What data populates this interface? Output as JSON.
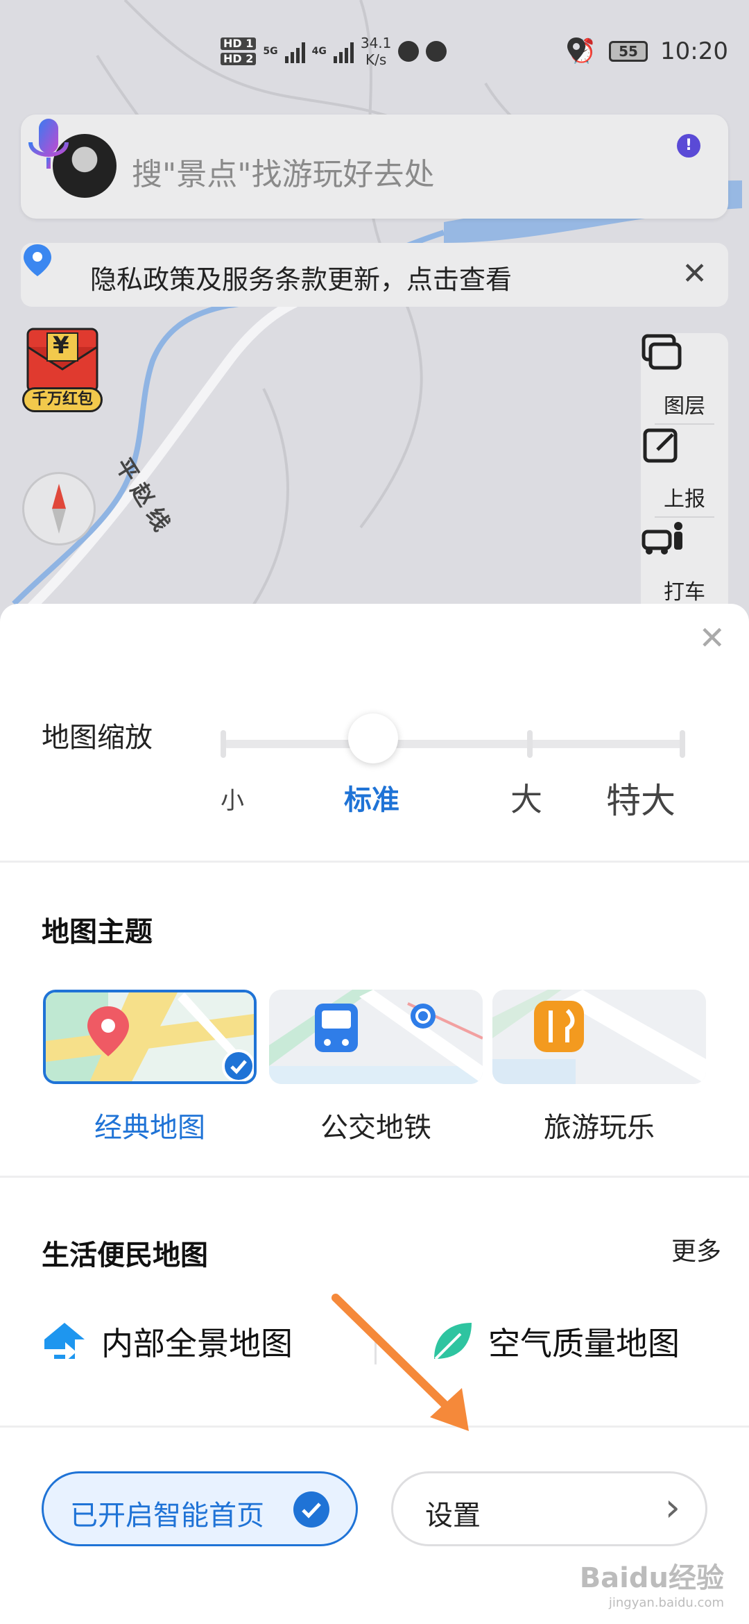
{
  "status_bar": {
    "speed_value": "34.1",
    "speed_unit": "K/s",
    "battery": "55",
    "time": "10:20",
    "net_5g": "5G",
    "net_4g": "4G"
  },
  "map": {
    "road_label": "平赵线"
  },
  "search": {
    "placeholder": "搜\"景点\"找游玩好去处",
    "mic_badge": "!"
  },
  "notice": {
    "text": "隐私政策及服务条款更新，点击查看",
    "close": "✕"
  },
  "promo": {
    "yen": "¥",
    "label": "千万红包"
  },
  "tools": [
    {
      "label": "图层",
      "icon": "layers-icon"
    },
    {
      "label": "上报",
      "icon": "report-edit-icon"
    },
    {
      "label": "打车",
      "icon": "taxi-icon"
    }
  ],
  "sheet": {
    "close": "✕",
    "zoom": {
      "title": "地图缩放",
      "levels": [
        "小",
        "标准",
        "大",
        "特大"
      ],
      "selected": "标准"
    },
    "themes": {
      "title": "地图主题",
      "items": [
        {
          "label": "经典地图",
          "selected": true,
          "icon": "location-pin-icon"
        },
        {
          "label": "公交地铁",
          "selected": false,
          "icon": "bus-icon"
        },
        {
          "label": "旅游玩乐",
          "selected": false,
          "icon": "fork-knife-icon"
        }
      ]
    },
    "life": {
      "title": "生活便民地图",
      "more": "更多",
      "items": [
        {
          "label": "内部全景地图",
          "icon": "panorama-arrow-icon"
        },
        {
          "label": "空气质量地图",
          "icon": "leaf-icon"
        }
      ]
    },
    "buttons": {
      "smart_home": "已开启智能首页",
      "settings": "设置",
      "settings_chevron": "›"
    }
  },
  "watermark": {
    "brand": "Baidu经验",
    "url": "jingyan.baidu.com"
  },
  "colors": {
    "accent": "#1f73d6",
    "annotation_arrow": "#f5893a",
    "map_bg": "#dcdce1",
    "water": "#8fb4e3"
  }
}
